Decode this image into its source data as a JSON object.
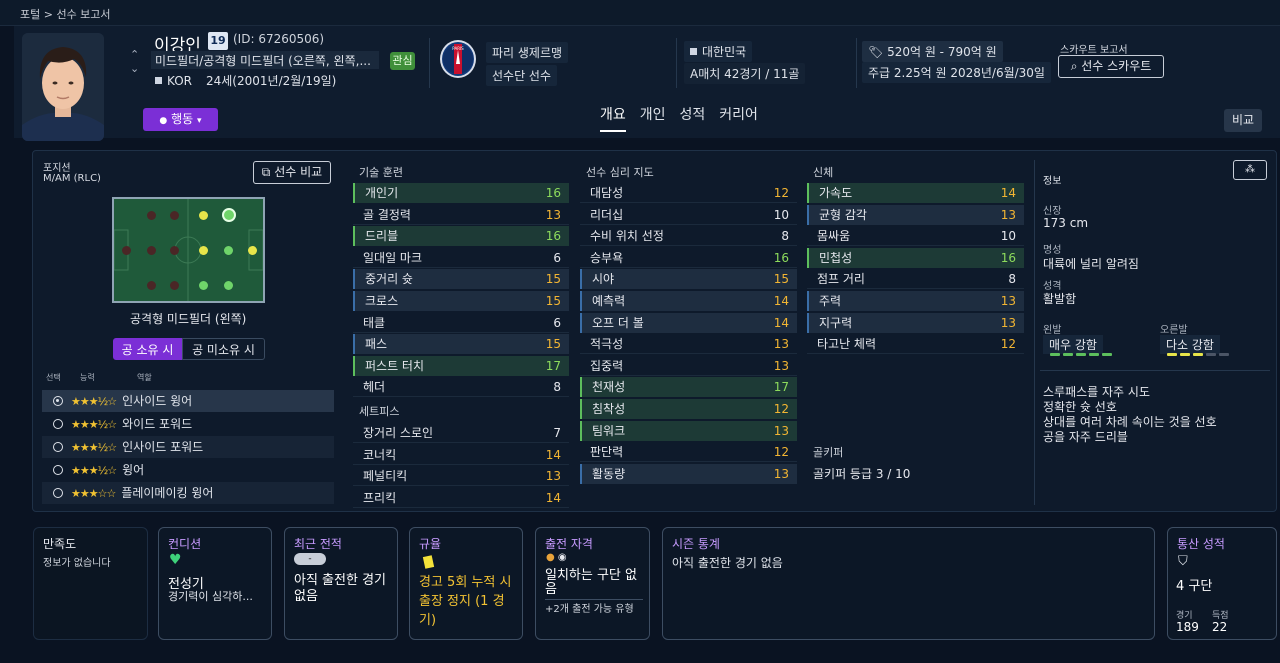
{
  "breadcrumb": "포털 > 선수 보고서",
  "player": {
    "name": "이강인",
    "number": "19",
    "id": "(ID: 67260506)",
    "positions": "미드필더/공격형 미드필더 (오른쪽, 왼쪽,...",
    "favorite": "관심",
    "nation_code": "KOR",
    "age": "24세(2001년/2월/19일)",
    "mood": "행동"
  },
  "club": {
    "name": "파리 생제르맹",
    "role": "선수단 선수"
  },
  "nation": {
    "name": "대한민국",
    "caps": "A매치 42경기 / 11골"
  },
  "contract": {
    "value": "520억 원 - 790억 원",
    "wage": "주급 2.25억 원 2028년/6월/30일"
  },
  "scout": {
    "label": "스카우트 보고서",
    "button": "선수 스카우트"
  },
  "tabs": [
    "개요",
    "개인",
    "성적",
    "커리어"
  ],
  "compare_label": "비교",
  "position_panel": {
    "title": "포지션",
    "value": "M/AM (RLC)",
    "compare": "선수 비교",
    "pitch_label": "공격형 미드필더 (왼쪽)",
    "toggle_on": "공 소유 시",
    "toggle_off": "공 미소유 시",
    "col_select": "선택",
    "col_ability": "능력",
    "col_role": "역할",
    "roles": [
      {
        "name": "인사이드 윙어",
        "stars": "★★★½☆"
      },
      {
        "name": "와이드 포워드",
        "stars": "★★★½☆"
      },
      {
        "name": "인사이드 포워드",
        "stars": "★★★½☆"
      },
      {
        "name": "윙어",
        "stars": "★★★½☆"
      },
      {
        "name": "플레이메이킹 윙어",
        "stars": "★★★☆☆"
      }
    ]
  },
  "technical": {
    "title": "기술 훈련",
    "rows": [
      {
        "name": "개인기",
        "value": "16"
      },
      {
        "name": "골 결정력",
        "value": "13"
      },
      {
        "name": "드리블",
        "value": "16"
      },
      {
        "name": "일대일 마크",
        "value": "6"
      },
      {
        "name": "중거리 슛",
        "value": "15"
      },
      {
        "name": "크로스",
        "value": "15"
      },
      {
        "name": "태클",
        "value": "6"
      },
      {
        "name": "패스",
        "value": "15"
      },
      {
        "name": "퍼스트 터치",
        "value": "17"
      },
      {
        "name": "헤더",
        "value": "8"
      }
    ]
  },
  "setpieces": {
    "title": "세트피스",
    "rows": [
      {
        "name": "장거리 스로인",
        "value": "7"
      },
      {
        "name": "코너킥",
        "value": "14"
      },
      {
        "name": "페널티킥",
        "value": "13"
      },
      {
        "name": "프리킥",
        "value": "14"
      }
    ]
  },
  "mental": {
    "title": "선수 심리 지도",
    "rows": [
      {
        "name": "대담성",
        "value": "12"
      },
      {
        "name": "리더십",
        "value": "10"
      },
      {
        "name": "수비 위치 선정",
        "value": "8"
      },
      {
        "name": "승부욕",
        "value": "16"
      },
      {
        "name": "시야",
        "value": "15"
      },
      {
        "name": "예측력",
        "value": "14"
      },
      {
        "name": "오프 더 볼",
        "value": "14"
      },
      {
        "name": "적극성",
        "value": "13"
      },
      {
        "name": "집중력",
        "value": "13"
      },
      {
        "name": "천재성",
        "value": "17"
      },
      {
        "name": "침착성",
        "value": "12"
      },
      {
        "name": "팀워크",
        "value": "13"
      },
      {
        "name": "판단력",
        "value": "12"
      },
      {
        "name": "활동량",
        "value": "13"
      }
    ]
  },
  "physical": {
    "title": "신체",
    "rows": [
      {
        "name": "가속도",
        "value": "14"
      },
      {
        "name": "균형 감각",
        "value": "13"
      },
      {
        "name": "몸싸움",
        "value": "10"
      },
      {
        "name": "민첩성",
        "value": "16"
      },
      {
        "name": "점프 거리",
        "value": "8"
      },
      {
        "name": "주력",
        "value": "13"
      },
      {
        "name": "지구력",
        "value": "13"
      },
      {
        "name": "타고난 체력",
        "value": "12"
      }
    ]
  },
  "goalkeeper": {
    "title": "골키퍼",
    "rating": "골키퍼 등급 3 / 10"
  },
  "info": {
    "title": "정보",
    "height_label": "신장",
    "height": "173 cm",
    "fame_label": "명성",
    "fame": "대륙에 널리 알려짐",
    "personality_label": "성격",
    "personality": "활발함",
    "left_foot_label": "왼발",
    "left_foot": "매우 강함",
    "right_foot_label": "오른발",
    "right_foot": "다소 강함",
    "traits": [
      "스루패스를 자주 시도",
      "정확한 슛 선호",
      "상대를 여러 차례 속이는 것을 선호",
      "공을 자주 드리블"
    ]
  },
  "cards": {
    "satisfaction": {
      "title": "만족도",
      "text": "정보가 없습니다"
    },
    "condition": {
      "title": "컨디션",
      "main": "전성기",
      "sub": "경기력이 심각하..."
    },
    "recent": {
      "title": "최근 전적",
      "badge": "-",
      "text": "아직 출전한 경기 없음"
    },
    "discipline": {
      "title": "규율",
      "text": "경고 5회 누적 시 출장 정지 (1 경기)"
    },
    "eligibility": {
      "title": "출전 자격",
      "text": "일치하는 구단 없음",
      "sub": "+2개 출전 가능 유형"
    },
    "season": {
      "title": "시즌 통계",
      "text": "아직 출전한 경기 없음"
    },
    "career": {
      "title": "통산 성적",
      "division": "4 구단",
      "apps_label": "경기",
      "apps": "189",
      "goals_label": "득점",
      "goals": "22"
    }
  }
}
